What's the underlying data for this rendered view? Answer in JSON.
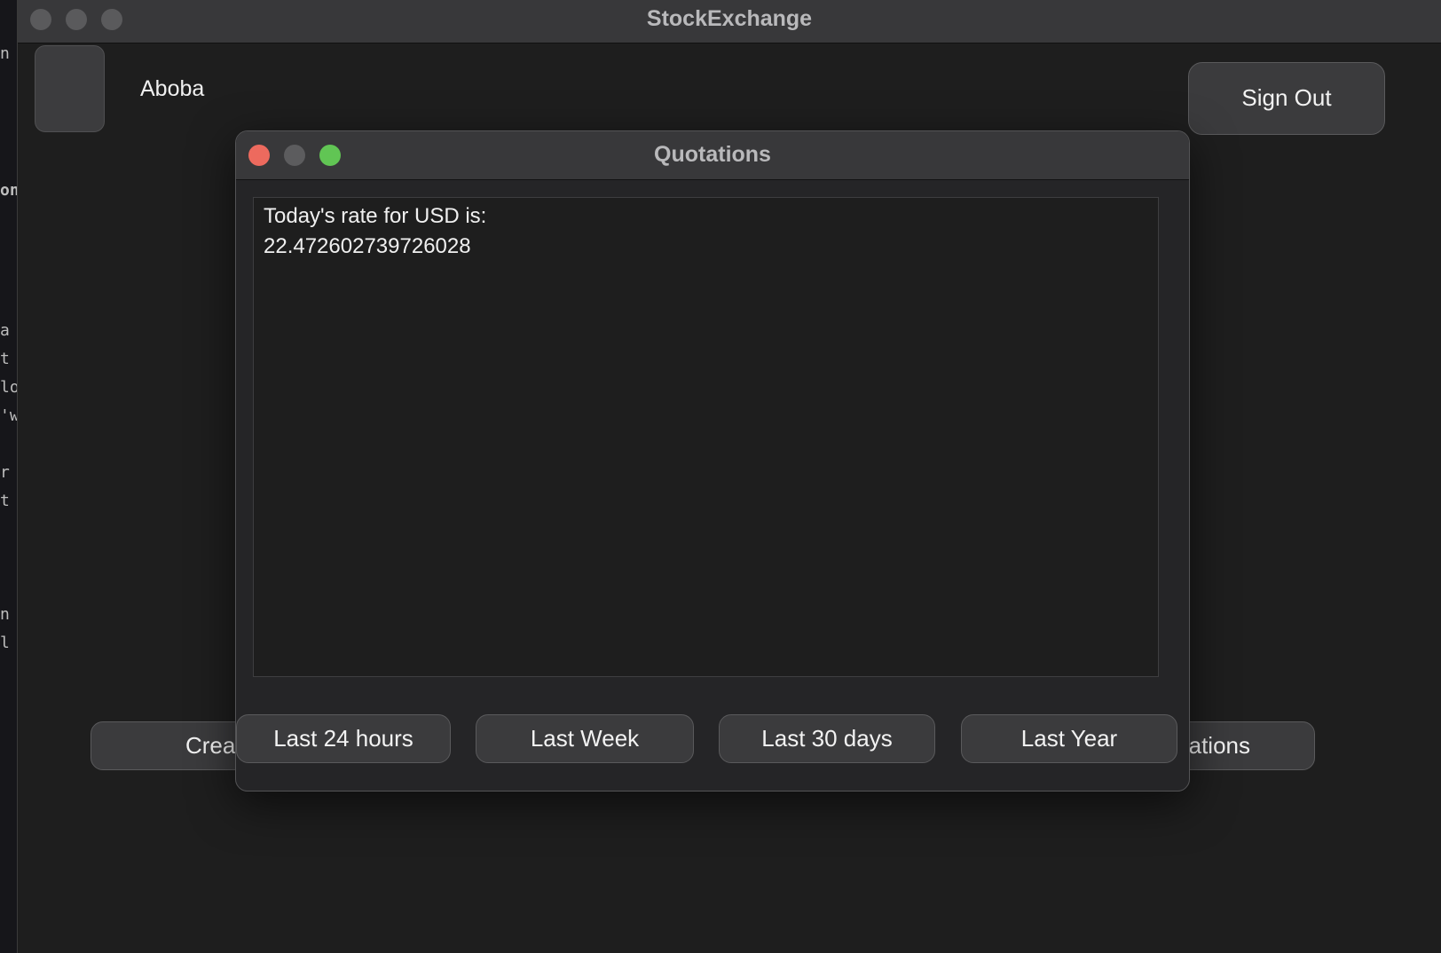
{
  "background_editor": {
    "lines": [
      {
        "text": "n"
      },
      {
        "text": "on"
      },
      {
        "text": "a"
      },
      {
        "text": "t"
      },
      {
        "text": "lo"
      },
      {
        "text": "'w"
      },
      {
        "text": " r"
      },
      {
        "text": "t"
      },
      {
        "text": " "
      },
      {
        "text": "n"
      },
      {
        "text": "l"
      }
    ]
  },
  "main_window": {
    "title": "StockExchange",
    "user": {
      "name": "Aboba"
    },
    "sign_out_label": "Sign Out",
    "bottom_button": {
      "left_label": "Crea",
      "right_label": "quotations"
    }
  },
  "quotations_dialog": {
    "title": "Quotations",
    "rate_line_1": "Today's rate for USD is:",
    "rate_line_2": "22.472602739726028",
    "period_buttons": [
      {
        "label": "Last 24 hours"
      },
      {
        "label": "Last Week"
      },
      {
        "label": "Last 30 days"
      },
      {
        "label": "Last Year"
      }
    ]
  },
  "colors": {
    "close": "#ed6a5e",
    "minimize": "#5c5c5e",
    "zoom": "#61c554"
  }
}
